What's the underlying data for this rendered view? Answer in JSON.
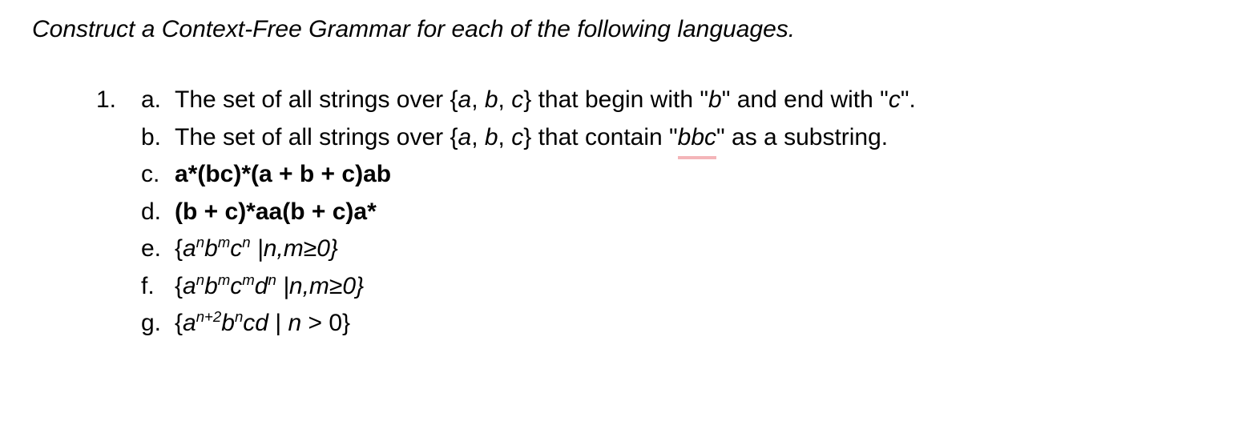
{
  "instruction": "Construct a Context-Free Grammar for each of the following languages.",
  "problem_number": "1.",
  "items": {
    "a": {
      "label": "a.",
      "prefix": "The set of all strings over {",
      "alpha_a": "a",
      "sep1": ", ",
      "alpha_b": "b",
      "sep2": ", ",
      "alpha_c": "c",
      "mid": "} that begin with \"",
      "quote_b": "b",
      "mid2": "\" and end with \"",
      "quote_c": "c",
      "suffix": "\"."
    },
    "b": {
      "label": "b.",
      "prefix": "The set of all strings over {",
      "alpha_a": "a",
      "sep1": ", ",
      "alpha_b": "b",
      "sep2": ", ",
      "alpha_c": "c",
      "mid": "} that contain \"",
      "quote_bbc": "bbc",
      "suffix": "\" as a substring."
    },
    "c": {
      "label": "c.",
      "text": "a*(bc)*(a + b + c)ab"
    },
    "d": {
      "label": "d.",
      "text": "(b + c)*aa(b + c)a*"
    },
    "e": {
      "label": "e.",
      "open": "{",
      "a": "a",
      "exp_a": "n",
      "b": "b",
      "exp_b": "m",
      "c": "c",
      "exp_c": "n",
      "cond": " |n,m≥0}"
    },
    "f": {
      "label": "f.",
      "open": "{",
      "a": "a",
      "exp_a": "n",
      "b": "b",
      "exp_b": "m",
      "c": "c",
      "exp_c": "m",
      "d": "d",
      "exp_d": "n",
      "cond": " |n,m≥0}"
    },
    "g": {
      "label": "g.",
      "open": "{",
      "a": "a",
      "exp_a": "n+2",
      "b": "b",
      "exp_b": "n",
      "cd": "cd",
      "cond_pre": " | ",
      "cond_var": "n",
      "cond_post": " > 0}"
    }
  }
}
